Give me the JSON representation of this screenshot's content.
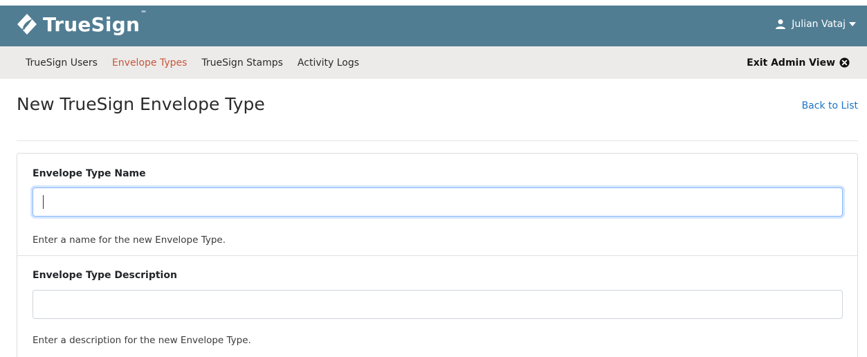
{
  "brand": {
    "name": "TrueSign",
    "tm": "™"
  },
  "user": {
    "name": "Julian Vataj",
    "icon": "user-icon"
  },
  "subnav": {
    "links": [
      {
        "label": "TrueSign Users",
        "active": false
      },
      {
        "label": "Envelope Types",
        "active": true
      },
      {
        "label": "TrueSign Stamps",
        "active": false
      },
      {
        "label": "Activity Logs",
        "active": false
      }
    ],
    "exit_label": "Exit Admin View"
  },
  "page": {
    "title": "New TrueSign Envelope Type",
    "back_link": "Back to List"
  },
  "form": {
    "name_field": {
      "label": "Envelope Type Name",
      "value": "",
      "help": "Enter a name for the new Envelope Type."
    },
    "description_field": {
      "label": "Envelope Type Description",
      "value": "",
      "help": "Enter a description for the new Envelope Type."
    }
  },
  "colors": {
    "header": "#517d93",
    "subnav": "#ecebe9",
    "active_link": "#c8553d",
    "link": "#1a73c8"
  }
}
